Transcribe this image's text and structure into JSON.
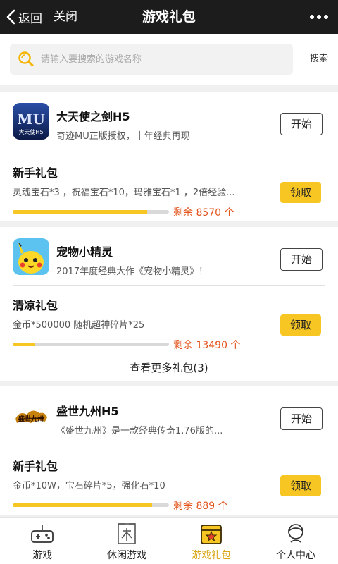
{
  "header": {
    "back_label": "返回",
    "close_label": "关闭",
    "title": "游戏礼包"
  },
  "search": {
    "placeholder": "请输入要搜索的游戏名称",
    "button_label": "搜索"
  },
  "games": [
    {
      "name": "大天使之剑H5",
      "desc": "奇迹MU正版授权，十年经典再现",
      "start_label": "开始",
      "icon": "mu-logo-icon",
      "gifts": [
        {
          "title": "新手礼包",
          "items": "灵魂宝石*3 ，祝福宝石*10，玛雅宝石*1 ，2倍经验...",
          "claim_label": "领取",
          "remain_text": "剩余 8570 个",
          "progress": 0.86
        }
      ]
    },
    {
      "name": "宠物小精灵",
      "desc": "2017年度经典大作《宠物小精灵》！",
      "start_label": "开始",
      "icon": "pikachu-icon",
      "gifts": [
        {
          "title": "清凉礼包",
          "items": "金币*500000 随机超神碎片*25",
          "claim_label": "领取",
          "remain_text": "剩余 13490 个",
          "progress": 0.14
        }
      ],
      "more_label": "查看更多礼包(3)"
    },
    {
      "name": "盛世九州H5",
      "desc": "《盛世九州》是一款经典传奇1.76版的...",
      "start_label": "开始",
      "icon": "shengshi-jiuzhou-logo-icon",
      "gifts": [
        {
          "title": "新手礼包",
          "items": "金币*10W，宝石碎片*5，强化石*10",
          "claim_label": "领取",
          "remain_text": "剩余 889 个",
          "progress": 0.89
        }
      ]
    }
  ],
  "tabs": [
    {
      "label": "游戏",
      "icon": "gamepad-icon",
      "active": false
    },
    {
      "label": "休闲游戏",
      "icon": "leisure-icon",
      "active": false
    },
    {
      "label": "游戏礼包",
      "icon": "gift-box-icon",
      "active": true
    },
    {
      "label": "个人中心",
      "icon": "user-icon",
      "active": false
    }
  ],
  "colors": {
    "accent": "#f7c623",
    "remain": "#e2541c",
    "active_tab": "#d9a614",
    "topbar": "#1c1c1c"
  }
}
